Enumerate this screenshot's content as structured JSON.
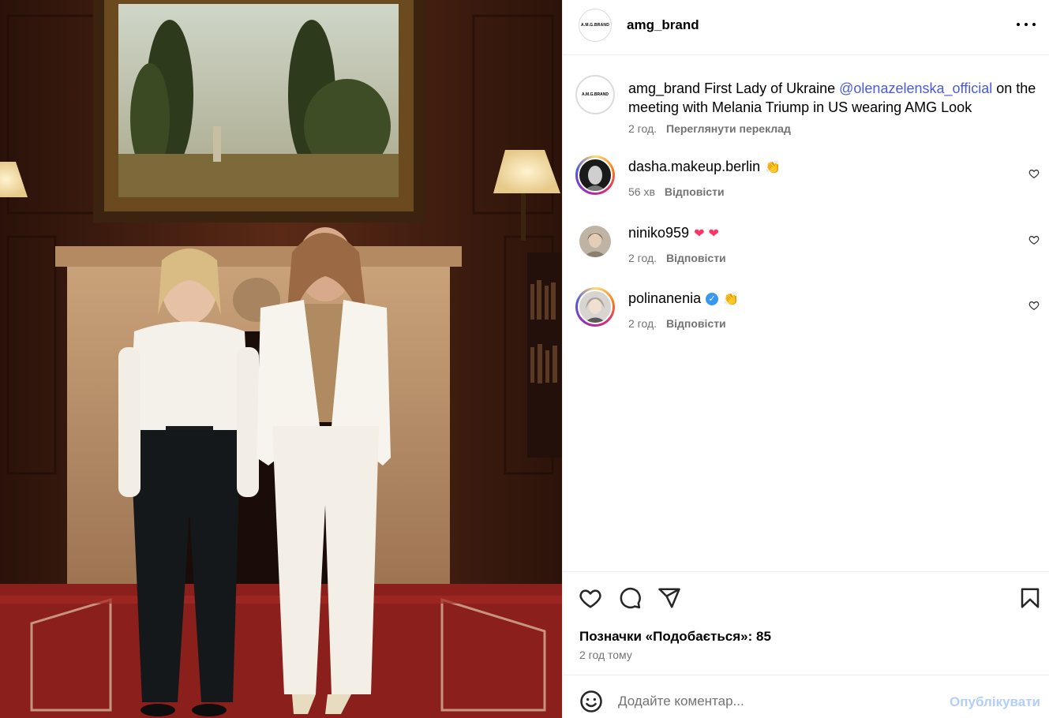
{
  "post": {
    "author": "amg_brand",
    "logo_text": "A.M.G.BRAND",
    "more_icon": "more-horizontal-icon",
    "photo_alt": "Post photo"
  },
  "caption": {
    "username": "amg_brand",
    "text_before": " First Lady of Ukraine ",
    "mention": "@olenazelenska_official",
    "text_after": " on the meeting with Melania Triump in US wearing AMG Look",
    "time": "2 год.",
    "translate_label": "Переглянути переклад"
  },
  "comments": [
    {
      "username": "dasha.makeup.berlin",
      "emoji": "👏",
      "time": "56 хв",
      "reply_label": "Відповісти",
      "has_story_ring": true,
      "verified": false
    },
    {
      "username": "niniko959",
      "emoji": "❤ ❤",
      "time": "2 год.",
      "reply_label": "Відповісти",
      "has_story_ring": false,
      "verified": false
    },
    {
      "username": "polinanenia",
      "emoji": "👏",
      "time": "2 год.",
      "reply_label": "Відповісти",
      "has_story_ring": true,
      "verified": true
    }
  ],
  "actions": {
    "icons": [
      "heart-icon",
      "comment-icon",
      "share-icon",
      "bookmark-icon"
    ],
    "likes_text": "Позначки «Подобається»: 85",
    "posted_ago": "2 год тому"
  },
  "composer": {
    "placeholder": "Додайте коментар...",
    "post_label": "Опублікувати",
    "emoji_icon": "smiley-icon"
  },
  "colors": {
    "mention": "#4a5bd4",
    "muted": "#737373",
    "post_button_disabled": "#b3cef9",
    "verified": "#3897f0",
    "divider": "#efefef"
  }
}
